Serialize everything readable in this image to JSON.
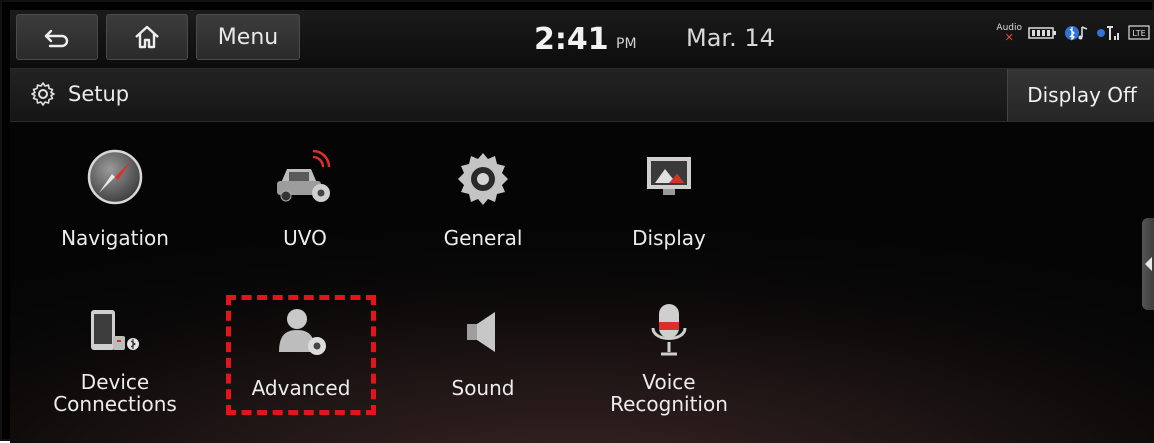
{
  "topbar": {
    "back_icon": "back-arrow-icon",
    "home_icon": "home-icon",
    "menu_label": "Menu",
    "time": "2:41",
    "ampm": "PM",
    "date": "Mar. 14",
    "audio_label": "Audio",
    "status_icons": [
      "audio-muted-icon",
      "battery-icon",
      "bluetooth-audio-icon",
      "signal-icon",
      "lte-icon"
    ],
    "lte_label": "LTE"
  },
  "header": {
    "icon": "gear-icon",
    "title": "Setup",
    "display_off_label": "Display Off"
  },
  "settings": {
    "navigation": "Navigation",
    "uvo": "UVO",
    "general": "General",
    "display": "Display",
    "device_connections_line1": "Device",
    "device_connections_line2": "Connections",
    "advanced": "Advanced",
    "sound": "Sound",
    "voice_recognition_line1": "Voice",
    "voice_recognition_line2": "Recognition"
  },
  "colors": {
    "highlight": "#e3151b",
    "accent_red": "#d9302a"
  }
}
